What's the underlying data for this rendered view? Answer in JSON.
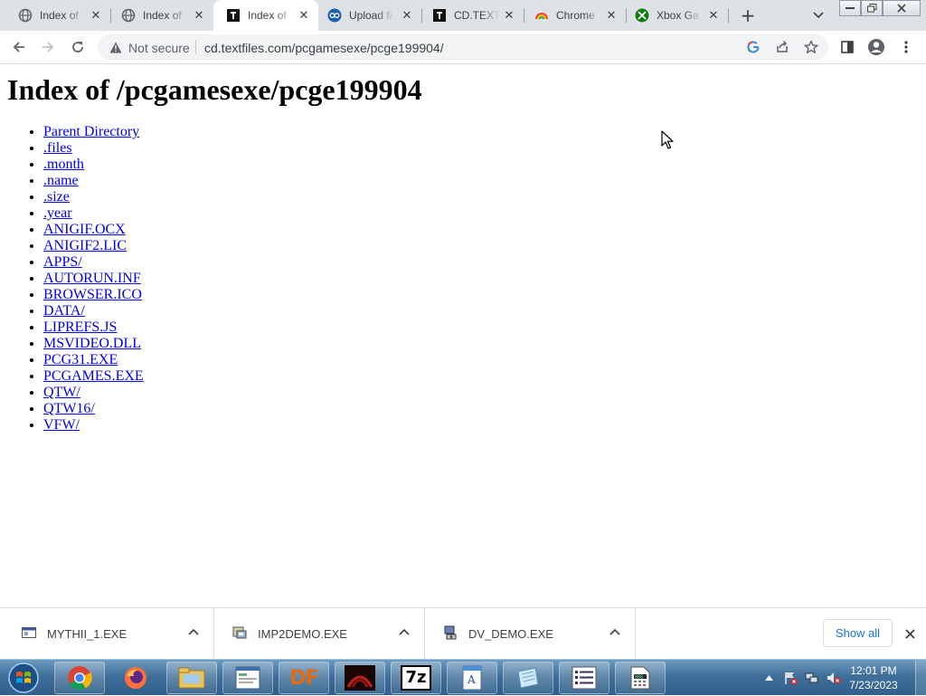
{
  "browser": {
    "tabs": [
      {
        "title": "Index of",
        "icon": "globe-icon"
      },
      {
        "title": "Index of",
        "icon": "globe-icon"
      },
      {
        "title": "Index of",
        "icon": "textfiles-icon"
      },
      {
        "title": "Upload fi",
        "icon": "upload-icon"
      },
      {
        "title": "CD.TEXTF",
        "icon": "textfiles-icon"
      },
      {
        "title": "Chrome",
        "icon": "chrome-rainbow-icon"
      },
      {
        "title": "Xbox Ga",
        "icon": "xbox-icon"
      }
    ],
    "active_tab_index": 2,
    "security_label": "Not secure",
    "url": "cd.textfiles.com/pcgamesexe/pcge199904/"
  },
  "page": {
    "heading": "Index of /pcgamesexe/pcge199904",
    "links": [
      "Parent Directory",
      ".files",
      ".month",
      ".name",
      ".size",
      ".year",
      "ANIGIF.OCX",
      "ANIGIF2.LIC",
      "APPS/",
      "AUTORUN.INF",
      "BROWSER.ICO",
      "DATA/",
      "LIPREFS.JS",
      "MSVIDEO.DLL",
      "PCG31.EXE",
      "PCGAMES.EXE",
      "QTW/",
      "QTW16/",
      "VFW/"
    ]
  },
  "downloads": {
    "items": [
      {
        "name": "MYTHII_1.EXE",
        "icon": "exe-window-icon"
      },
      {
        "name": "IMP2DEMO.EXE",
        "icon": "installer-icon"
      },
      {
        "name": "DV_DEMO.EXE",
        "icon": "setup-icon"
      }
    ],
    "show_all_label": "Show all"
  },
  "taskbar": {
    "apps": [
      "chrome-icon",
      "firefox-icon",
      "explorer-icon",
      "window-app-icon",
      "df-icon",
      "red-app-icon",
      "7zip-icon",
      "wordpad-icon",
      "notepad-icon",
      "list-icon",
      "calc-icon"
    ],
    "df_label": "DF",
    "sevenzip_label": "7z",
    "time": "12:01 PM",
    "date": "7/23/2023"
  },
  "colors": {
    "link": "#0000ee",
    "tab_strip": "#dee1e6",
    "show_all_text": "#1a73e8"
  }
}
